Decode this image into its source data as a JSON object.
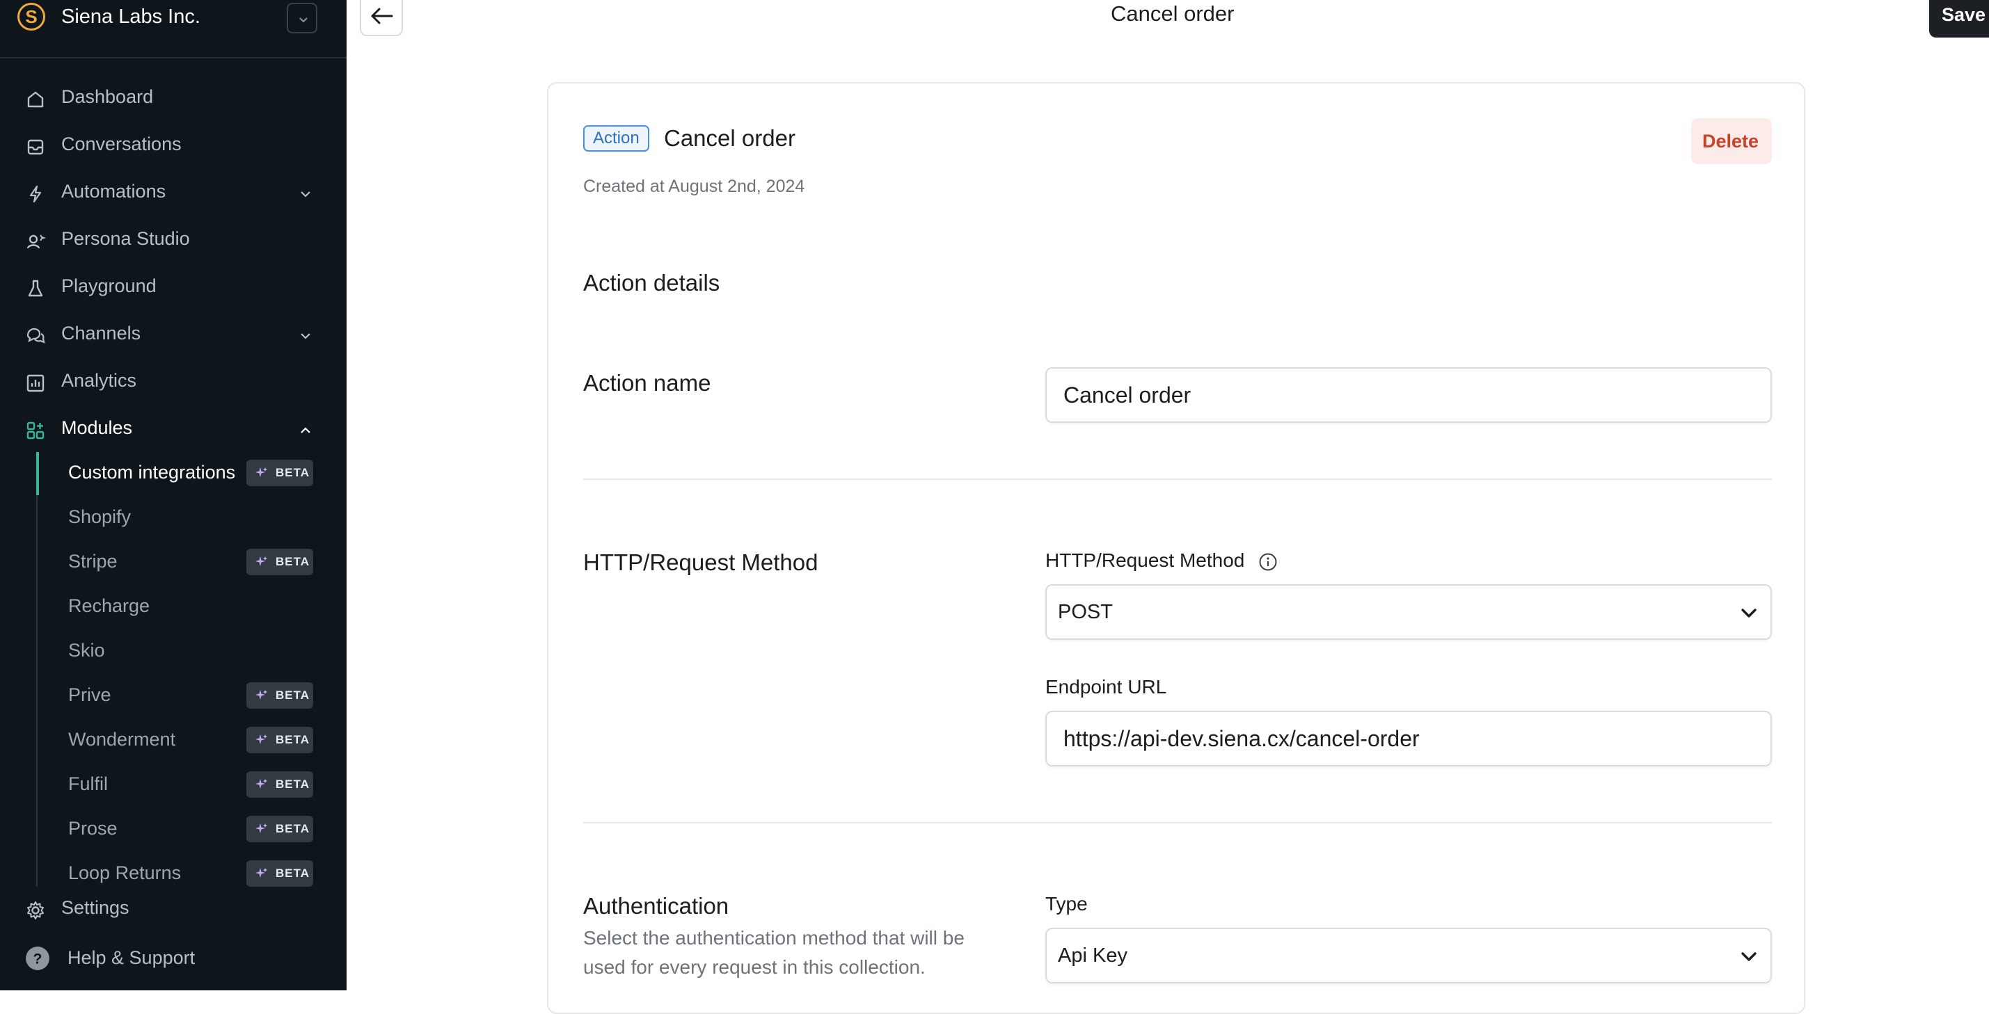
{
  "sidebar": {
    "org_name": "Siena Labs Inc.",
    "org_logo_letter": "S",
    "nav": {
      "dashboard": "Dashboard",
      "conversations": "Conversations",
      "automations": "Automations",
      "persona_studio": "Persona Studio",
      "playground": "Playground",
      "channels": "Channels",
      "analytics": "Analytics",
      "modules": "Modules"
    },
    "modules": [
      {
        "label": "Custom integrations",
        "beta": "BETA"
      },
      {
        "label": "Shopify"
      },
      {
        "label": "Stripe",
        "beta": "BETA"
      },
      {
        "label": "Recharge"
      },
      {
        "label": "Skio"
      },
      {
        "label": "Prive",
        "beta": "BETA"
      },
      {
        "label": "Wonderment",
        "beta": "BETA"
      },
      {
        "label": "Fulfil",
        "beta": "BETA"
      },
      {
        "label": "Prose",
        "beta": "BETA"
      },
      {
        "label": "Loop Returns",
        "beta": "BETA"
      }
    ],
    "settings": "Settings",
    "help": "Help & Support"
  },
  "topbar": {
    "title": "Cancel order",
    "save_label": "Save"
  },
  "card": {
    "tag": "Action",
    "title": "Cancel order",
    "created": "Created at August 2nd, 2024",
    "delete_label": "Delete",
    "details_heading": "Action details",
    "action_name_label": "Action name",
    "action_name_value": "Cancel order",
    "http_section_label": "HTTP/Request Method",
    "http_field_label": "HTTP/Request Method",
    "http_method_value": "POST",
    "endpoint_label": "Endpoint URL",
    "endpoint_value": "https://api-dev.siena.cx/cancel-order",
    "auth_heading": "Authentication",
    "auth_desc": "Select the authentication method that will be used for every request in this collection.",
    "type_label": "Type",
    "type_value": "Api Key"
  },
  "colors": {
    "sidebar_bg": "#0f161b",
    "accent_teal": "#39b39a",
    "logo_orange": "#f0a93c",
    "delete_red": "#c8432c",
    "tag_blue": "#4a90e2"
  }
}
